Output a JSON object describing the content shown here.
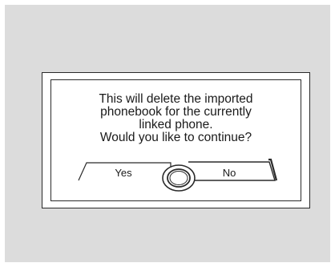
{
  "dialog": {
    "message_lines": [
      "This will delete the imported",
      "phonebook for the currently",
      "linked phone.",
      "Would  you like to continue?"
    ],
    "yes_label": "Yes",
    "no_label": "No",
    "selected_option": "No"
  },
  "colors": {
    "panel_background": "#dcdcdc",
    "dialog_background": "#ffffff",
    "line_color": "#2a2a2a"
  },
  "icons": {
    "selector_knob": "selector-knob-icon"
  }
}
